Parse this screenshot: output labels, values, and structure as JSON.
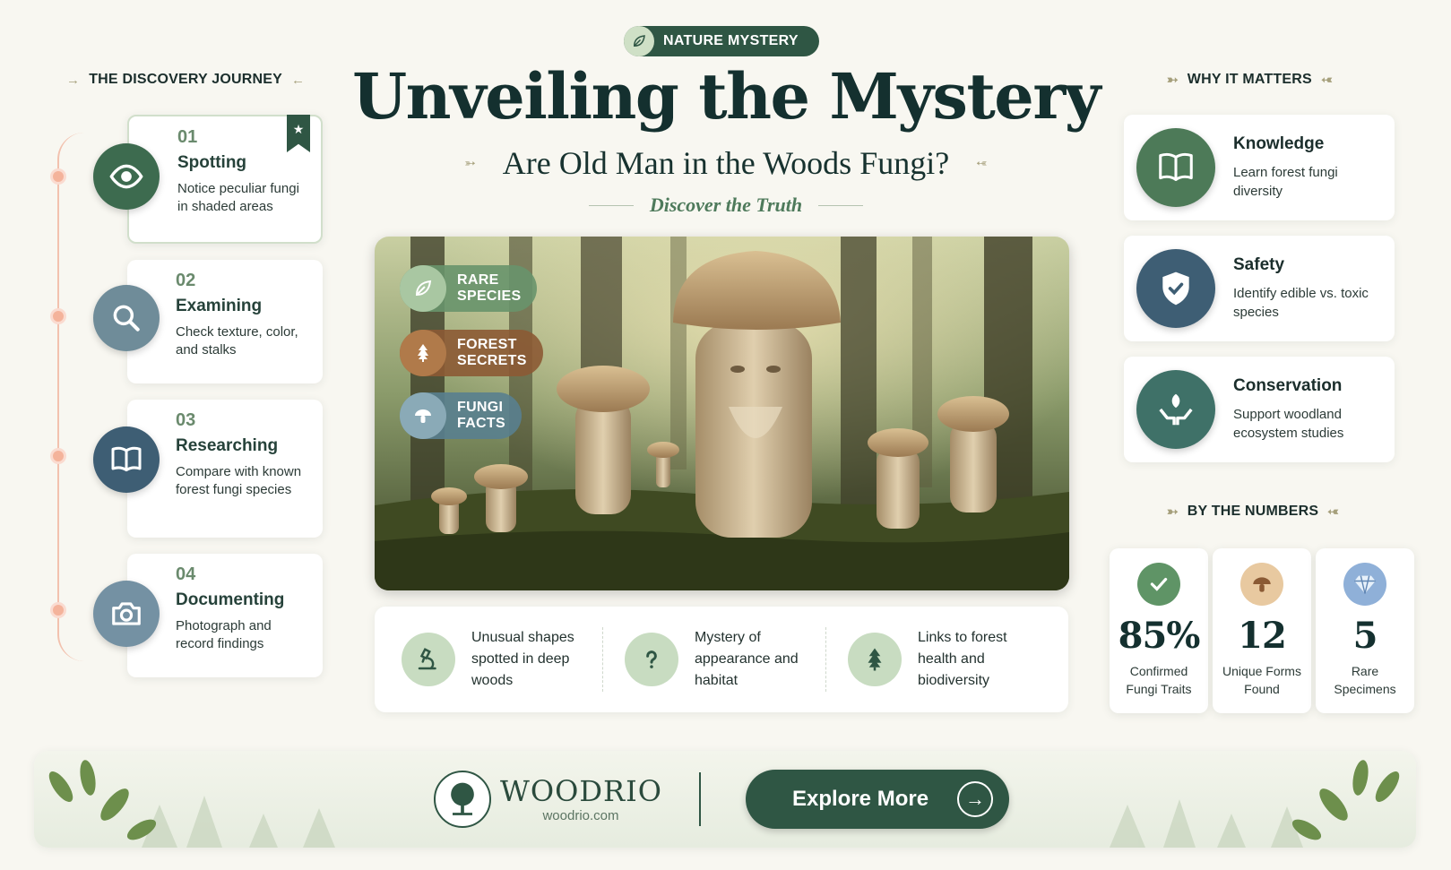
{
  "badge": {
    "label": "NATURE MYSTERY",
    "icon": "leaf-icon"
  },
  "title": "Unveiling the Mystery",
  "subtitle": "Are Old Man in the Woods Fungi?",
  "tagline": "Discover the Truth",
  "journey": {
    "heading": "THE DISCOVERY JOURNEY",
    "steps": [
      {
        "num": "01",
        "title": "Spotting",
        "desc": "Notice peculiar fungi in shaded areas",
        "icon": "eye-icon",
        "color": "#3d6b4f"
      },
      {
        "num": "02",
        "title": "Examining",
        "desc": "Check texture, color, and stalks",
        "icon": "magnifier-icon",
        "color": "#6f8c99"
      },
      {
        "num": "03",
        "title": "Researching",
        "desc": "Compare with known forest fungi species",
        "icon": "book-icon",
        "color": "#3e5e74"
      },
      {
        "num": "04",
        "title": "Documenting",
        "desc": "Photograph and record findings",
        "icon": "camera-icon",
        "color": "#7491a3"
      }
    ]
  },
  "hero": {
    "pills": [
      {
        "label_1": "RARE",
        "label_2": "SPECIES",
        "icon": "leaf-icon",
        "color": "#6f9a72"
      },
      {
        "label_1": "FOREST",
        "label_2": "SECRETS",
        "icon": "tree-icon",
        "color": "#8c5a34"
      },
      {
        "label_1": "FUNGI",
        "label_2": "FACTS",
        "icon": "mushroom-icon",
        "color": "#597f8f"
      }
    ]
  },
  "facts": [
    {
      "text": "Unusual shapes spotted in deep woods",
      "icon": "microscope-icon"
    },
    {
      "text": "Mystery of appearance and habitat",
      "icon": "question-icon"
    },
    {
      "text": "Links to forest health and biodiversity",
      "icon": "tree-icon"
    }
  ],
  "why": {
    "heading": "WHY IT MATTERS",
    "items": [
      {
        "title": "Knowledge",
        "desc": "Learn forest fungi diversity",
        "icon": "book-icon",
        "color": "#4d7a58"
      },
      {
        "title": "Safety",
        "desc": "Identify edible vs. toxic species",
        "icon": "shield-icon",
        "color": "#3e5e74"
      },
      {
        "title": "Conservation",
        "desc": "Support woodland ecosystem studies",
        "icon": "hands-leaf-icon",
        "color": "#3f7168"
      }
    ]
  },
  "numbers": {
    "heading": "BY THE NUMBERS",
    "items": [
      {
        "value": "85%",
        "label": "Confirmed Fungi Traits",
        "icon": "check-icon",
        "color": "#5f9466"
      },
      {
        "value": "12",
        "label": "Unique Forms Found",
        "icon": "mushroom-icon",
        "color": "#e8c9a0"
      },
      {
        "value": "5",
        "label": "Rare Specimens",
        "icon": "diamond-icon",
        "color": "#8fb0d8"
      }
    ]
  },
  "footer": {
    "brand": "WOODRIO",
    "url": "woodrio.com",
    "cta": "Explore More"
  }
}
